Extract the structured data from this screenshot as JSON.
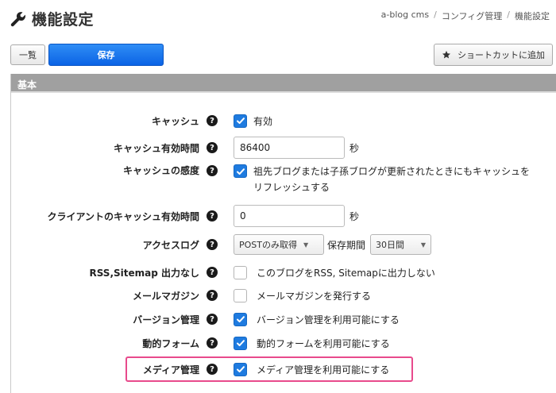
{
  "header": {
    "title": "機能設定",
    "breadcrumb": [
      "a-blog cms",
      "コンフィグ管理",
      "機能設定"
    ]
  },
  "toolbar": {
    "list_label": "一覧",
    "save_label": "保存",
    "shortcut_label": "ショートカットに追加"
  },
  "panel": {
    "heading": "基本",
    "rows": [
      {
        "label": "キャッシュ",
        "type": "checkbox",
        "checked": true,
        "text": "有効"
      },
      {
        "label": "キャッシュ有効時間",
        "type": "text",
        "value": "86400",
        "unit": "秒"
      },
      {
        "label": "キャッシュの感度",
        "type": "checkbox",
        "checked": true,
        "text": "祖先ブログまたは子孫ブログが更新されたときにもキャッシュをリフレッシュする"
      },
      {
        "label": "クライアントのキャッシュ有効時間",
        "type": "text",
        "value": "0",
        "unit": "秒"
      },
      {
        "label": "アクセスログ",
        "type": "select",
        "value": "POSTのみ取得",
        "period_label": "保存期間",
        "period_value": "30日間"
      },
      {
        "label": "RSS,Sitemap 出力なし",
        "type": "checkbox",
        "checked": false,
        "text": "このブログをRSS, Sitemapに出力しない"
      },
      {
        "label": "メールマガジン",
        "type": "checkbox",
        "checked": false,
        "text": "メールマガジンを発行する"
      },
      {
        "label": "バージョン管理",
        "type": "checkbox",
        "checked": true,
        "text": "バージョン管理を利用可能にする"
      },
      {
        "label": "動的フォーム",
        "type": "checkbox",
        "checked": true,
        "text": "動的フォームを利用可能にする"
      },
      {
        "label": "メディア管理",
        "type": "checkbox",
        "checked": true,
        "text": "メディア管理を利用可能にする",
        "highlighted": true
      }
    ]
  },
  "colors": {
    "accent": "#1e7be0",
    "save_button": "#0b63e5",
    "header_bar": "#a0a0a0",
    "highlight": "#e84a8c"
  },
  "icons": {
    "title": "wrench-icon",
    "shortcut": "star-icon",
    "help": "help-icon",
    "check": "check-icon"
  }
}
